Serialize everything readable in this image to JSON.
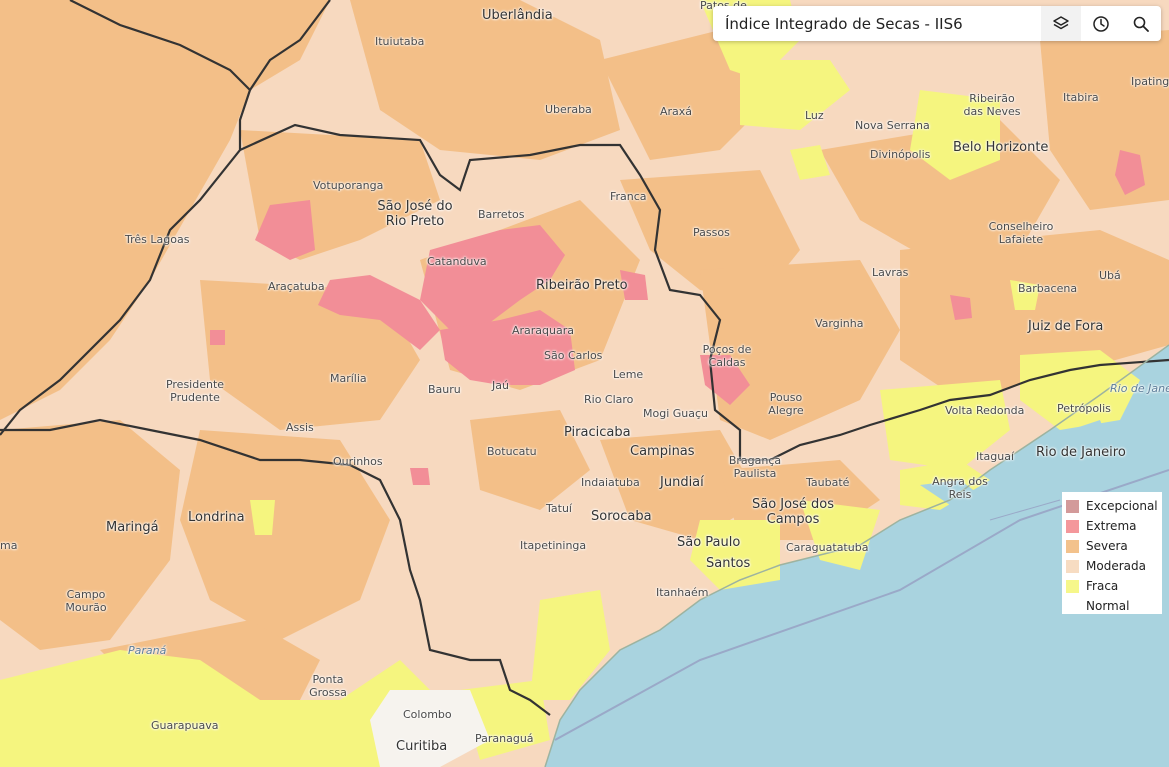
{
  "search": {
    "value": "Índice Integrado de Secas - IIS6"
  },
  "toolbar": {
    "layers_icon": "layers-icon",
    "history_icon": "clock-icon",
    "search_icon": "search-icon"
  },
  "legend": {
    "items": [
      {
        "label": "Excepcional",
        "color": "#d39a9a"
      },
      {
        "label": "Extrema",
        "color": "#f4979b"
      },
      {
        "label": "Severa",
        "color": "#f3c28c"
      },
      {
        "label": "Moderada",
        "color": "#f7dcc2"
      },
      {
        "label": "Fraca",
        "color": "#f6f78a"
      },
      {
        "label": "Normal",
        "color": "#ffffff"
      }
    ]
  },
  "map": {
    "places": [
      "Uberlândia",
      "Ituiutaba",
      "Uberaba",
      "Araxá",
      "Luz",
      "Nova Serrana",
      "Divinópolis",
      "Belo Horizonte",
      "Ribeirão das Neves",
      "Itabira",
      "Ipatinga",
      "Votuporanga",
      "São José do Rio Preto",
      "Barretos",
      "Franca",
      "Passos",
      "Conselheiro Lafaiete",
      "Três Lagoas",
      "Catanduva",
      "Ribeirão Preto",
      "Araçatuba",
      "Lavras",
      "Ubá",
      "Barbacena",
      "Araraquara",
      "São Carlos",
      "Varginha",
      "Juiz de Fora",
      "Poços de Caldas",
      "Presidente Prudente",
      "Marília",
      "Bauru",
      "Jaú",
      "Leme",
      "Rio Claro",
      "Pouso Alegre",
      "Mogi Guaçu",
      "Volta Redonda",
      "Petrópolis",
      "Assis",
      "Piracicaba",
      "Campinas",
      "Ourinhos",
      "Botucatu",
      "Bragança Paulista",
      "Itaguaí",
      "Rio de Janeiro",
      "Indaiatuba",
      "Jundiaí",
      "Taubaté",
      "Angra dos Reis",
      "Maringá",
      "Londrina",
      "Tatuí",
      "Sorocaba",
      "São José dos Campos",
      "Itapetininga",
      "São Paulo",
      "Caraguatatuba",
      "Santos",
      "Itanhaém",
      "Campo Mourão",
      "Paraná",
      "Ponta Grossa",
      "Guarapuava",
      "Colombo",
      "Curitiba",
      "Paranaguá",
      "Rio de Janeiro",
      "Patos de",
      "ma"
    ]
  }
}
